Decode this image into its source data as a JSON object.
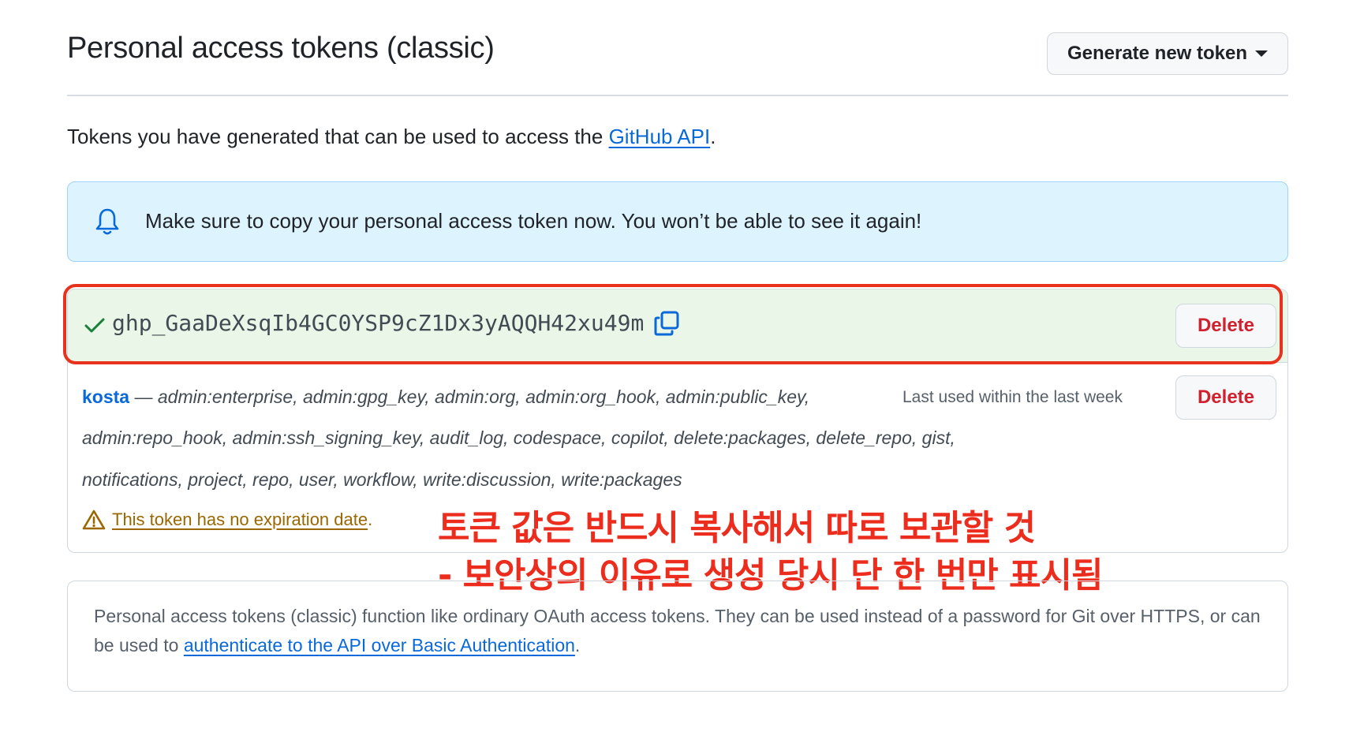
{
  "header": {
    "title": "Personal access tokens (classic)",
    "generate_button_label": "Generate new token"
  },
  "intro": {
    "text": "Tokens you have generated that can be used to access the ",
    "link_text": "GitHub API",
    "suffix": "."
  },
  "flash": {
    "icon": "bell-icon",
    "message": "Make sure to copy your personal access token now. You won’t be able to see it again!"
  },
  "new_token": {
    "value": "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",
    "delete_label": "Delete"
  },
  "token": {
    "name": "kosta",
    "separator": " — ",
    "scopes_line1": "admin:enterprise, admin:gpg_key, admin:org, admin:org_hook, admin:public_key,",
    "scopes_line2": "admin:repo_hook, admin:ssh_signing_key, audit_log, codespace, copilot, delete:packages, delete_repo, gist,",
    "scopes_line3": "notifications, project, repo, user, workflow, write:discussion, write:packages",
    "last_used": "Last used within the last week",
    "delete_label": "Delete",
    "warning": "This token has no expiration date"
  },
  "annotation": {
    "line1": "토큰 값은 반드시 복사해서 따로 보관할 것",
    "line2": "- 보안상의 이유로 생성 당시 단 한 번만 표시됨",
    "color": "#ec2d1e"
  },
  "info": {
    "text": "Personal access tokens (classic) function like ordinary OAuth access tokens. They can be used instead of a password for Git over HTTPS, or can be used to ",
    "link_text": "authenticate to the API over Basic Authentication",
    "suffix": "."
  },
  "colors": {
    "link": "#0969da",
    "flash_bg": "#ddf4ff",
    "success_bg": "#eaf6e7",
    "danger": "#cf222e",
    "attention": "#9a6700"
  }
}
